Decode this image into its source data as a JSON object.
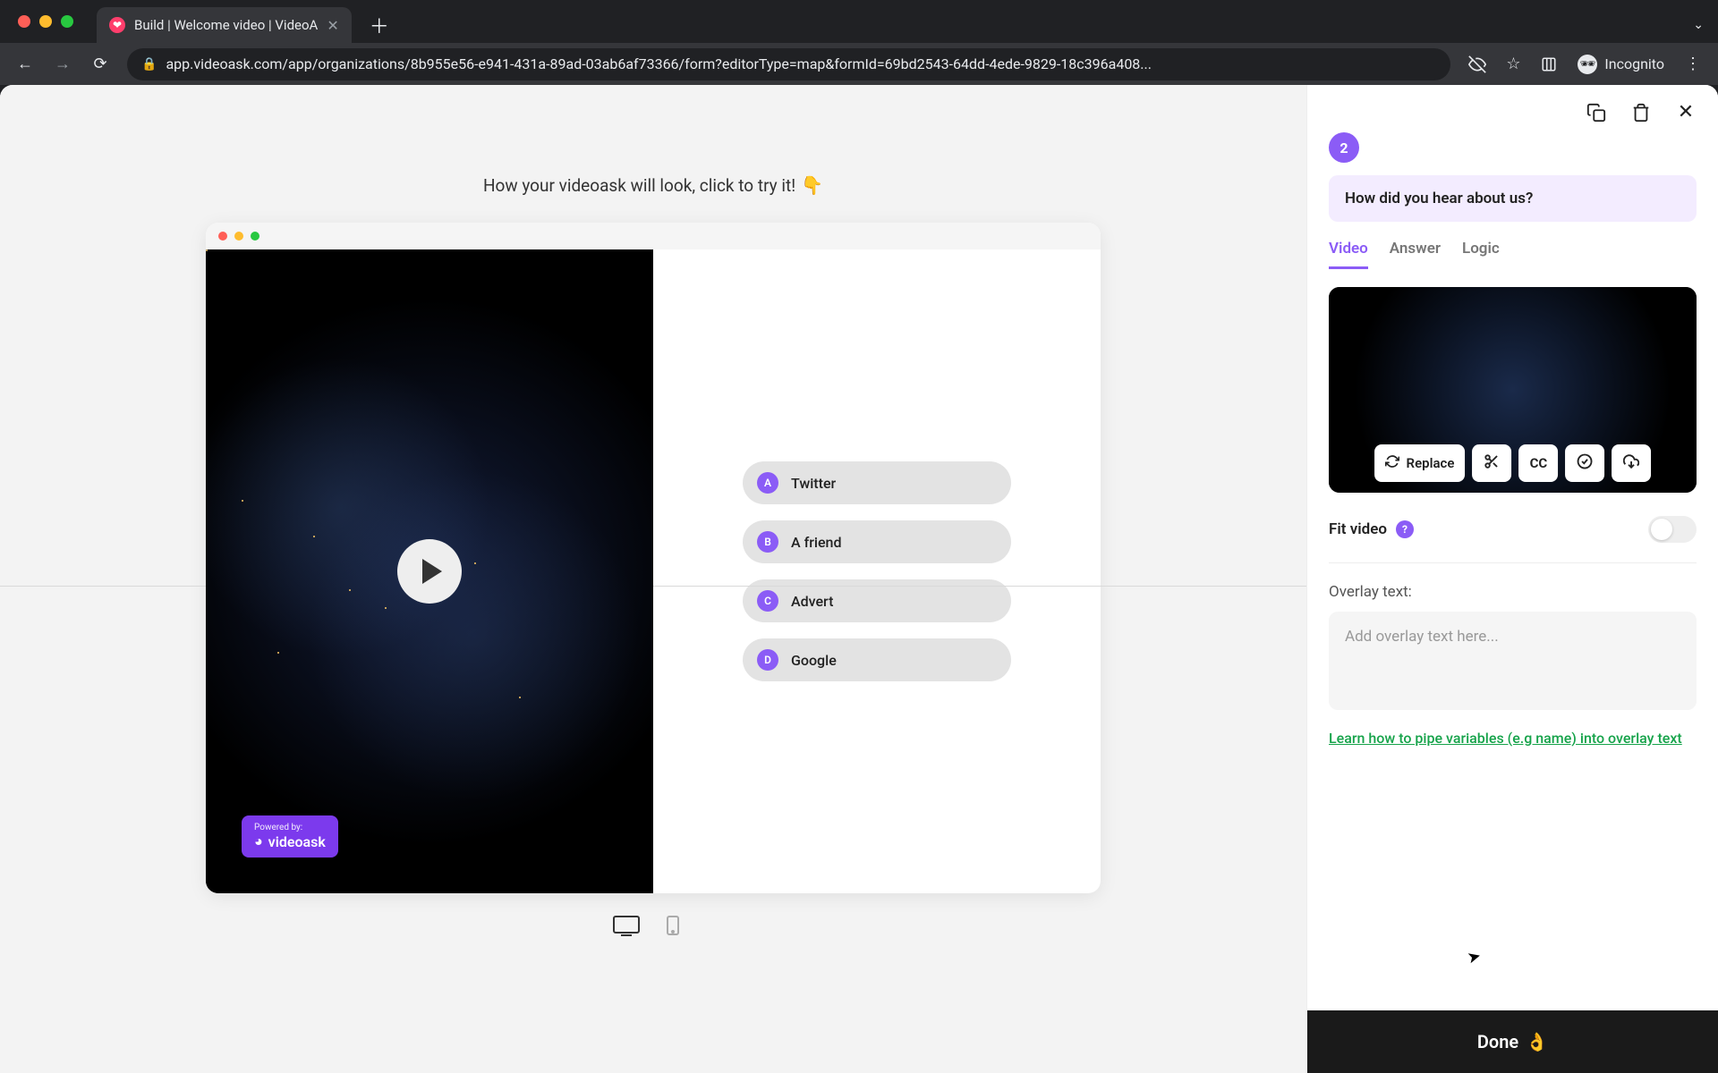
{
  "browser": {
    "tab_title": "Build | Welcome video | VideoA",
    "url": "app.videoask.com/app/organizations/8b955e56-e941-431a-89ad-03ab6af73366/form?editorType=map&formId=69bd2543-64dd-4ede-9829-18c396a408...",
    "incognito_label": "Incognito"
  },
  "preview": {
    "hint_text": "How your videoask will look, click to try it!",
    "hint_emoji": "👇",
    "powered_by_label": "Powered by:",
    "powered_by_brand": "videoask",
    "choices": [
      {
        "badge": "A",
        "label": "Twitter"
      },
      {
        "badge": "B",
        "label": "A friend"
      },
      {
        "badge": "C",
        "label": "Advert"
      },
      {
        "badge": "D",
        "label": "Google"
      }
    ]
  },
  "panel": {
    "step_number": "2",
    "question_text": "How did you hear about us?",
    "tabs": {
      "video": "Video",
      "answer": "Answer",
      "logic": "Logic"
    },
    "video_actions": {
      "replace": "Replace",
      "cc": "CC"
    },
    "fit_video_label": "Fit video",
    "overlay_label": "Overlay text:",
    "overlay_placeholder": "Add overlay text here...",
    "learn_link_text": "Learn how to pipe variables (e.g name) into overlay text",
    "done_label": "Done",
    "done_emoji": "👌"
  }
}
